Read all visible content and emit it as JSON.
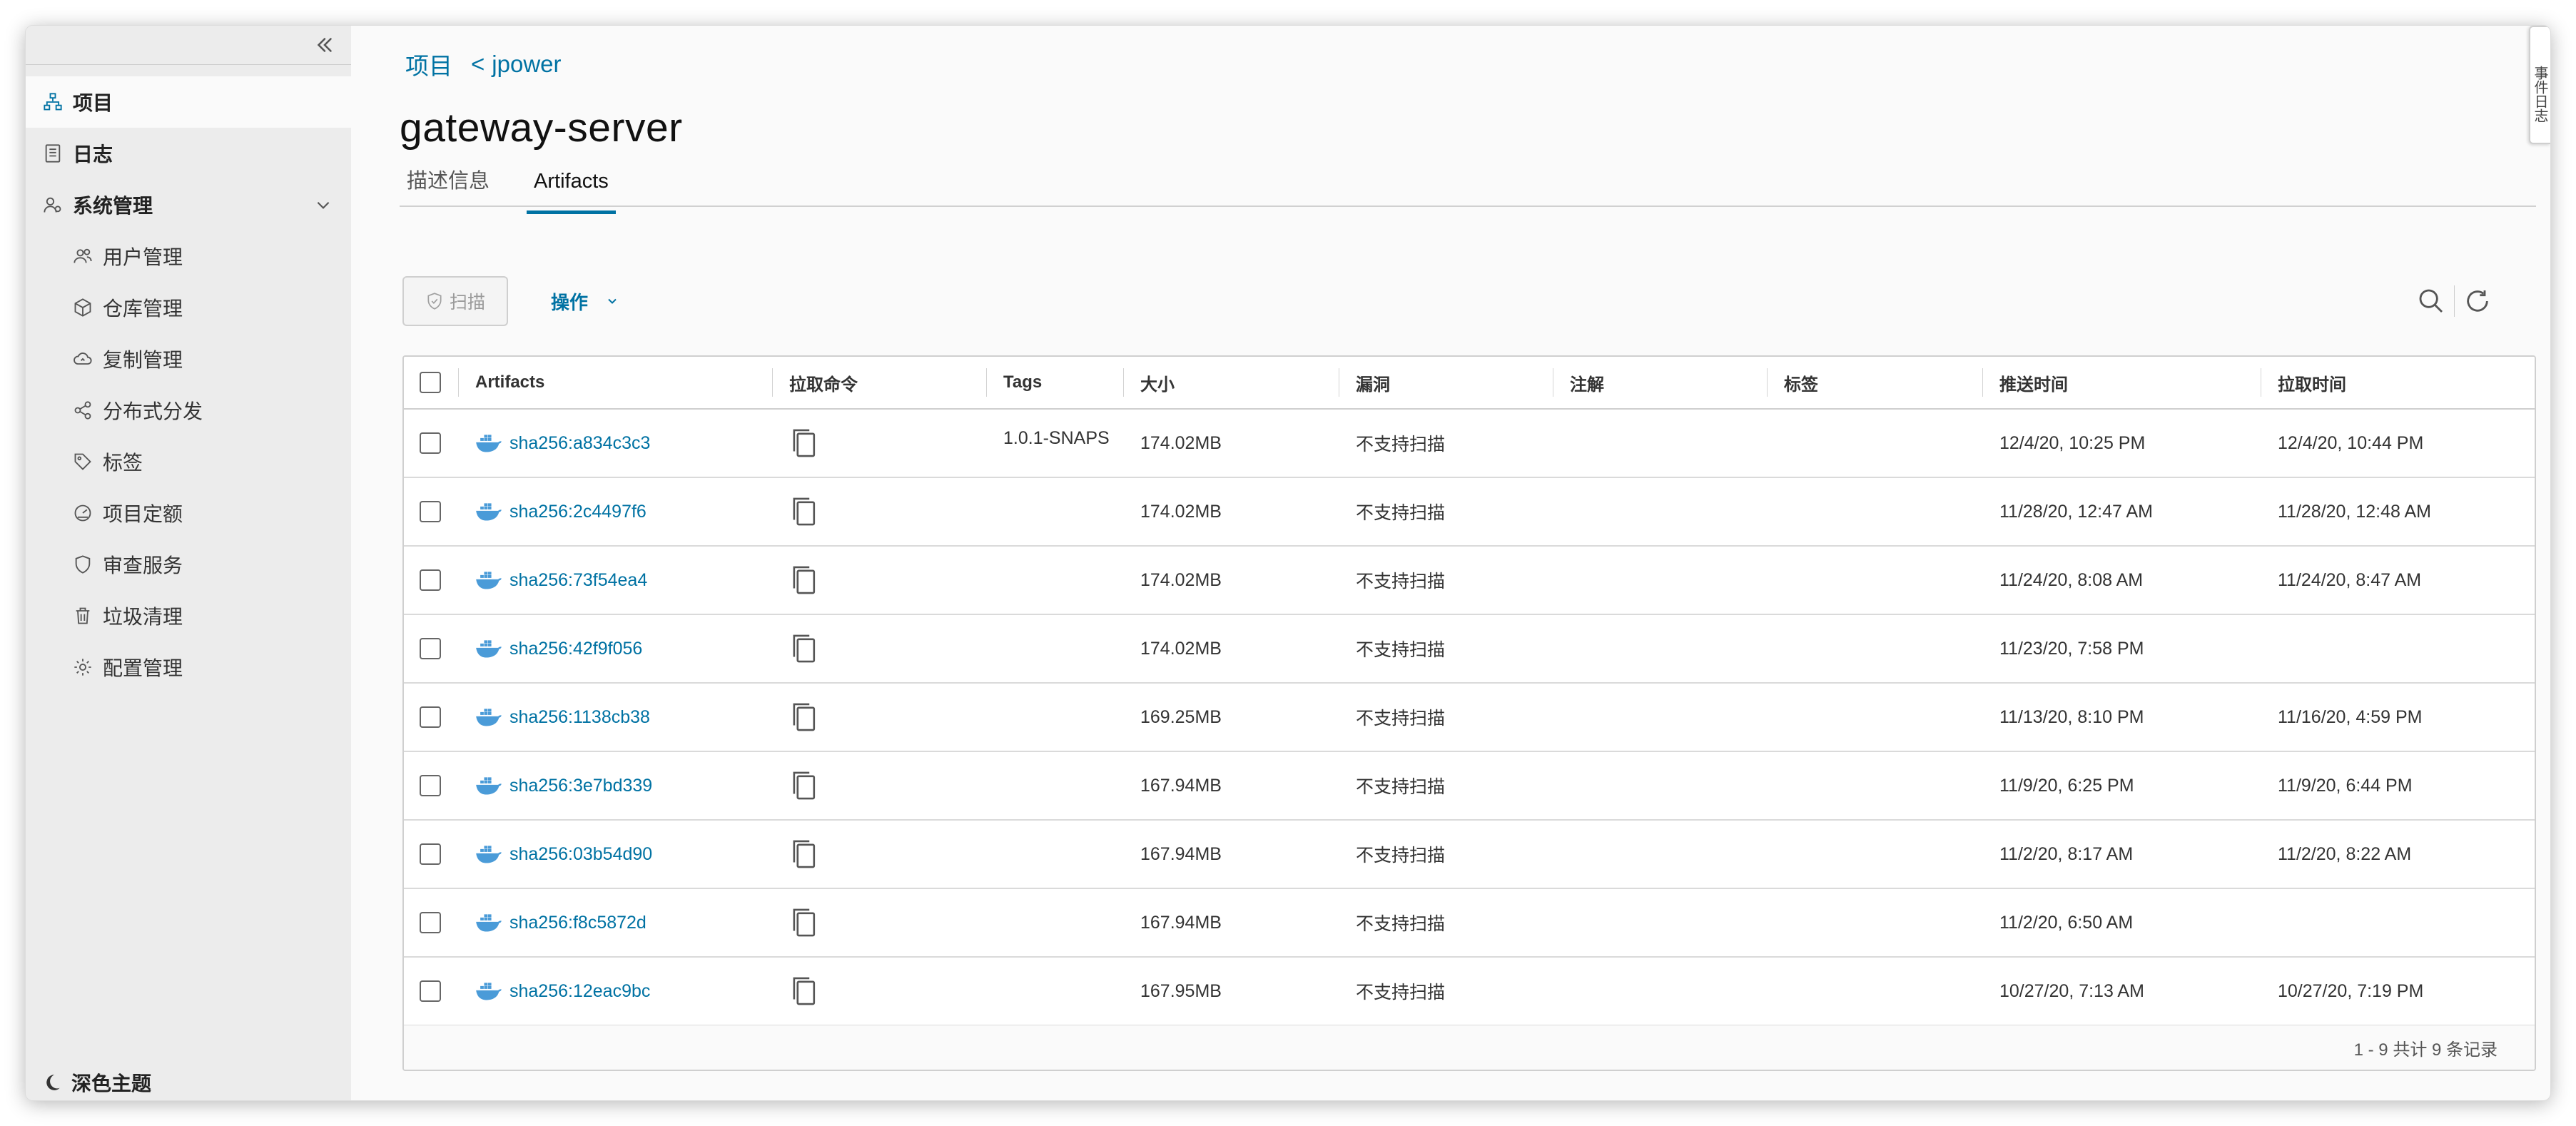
{
  "sidebar": {
    "items": [
      {
        "label": "项目",
        "icon": "project-icon"
      },
      {
        "label": "日志",
        "icon": "log-icon"
      },
      {
        "label": "系统管理",
        "icon": "admin-icon"
      },
      {
        "label": "用户管理",
        "icon": "users-icon"
      },
      {
        "label": "仓库管理",
        "icon": "registry-icon"
      },
      {
        "label": "复制管理",
        "icon": "replication-icon"
      },
      {
        "label": "分布式分发",
        "icon": "distribution-icon"
      },
      {
        "label": "标签",
        "icon": "tag-icon"
      },
      {
        "label": "项目定额",
        "icon": "quota-icon"
      },
      {
        "label": "审查服务",
        "icon": "shield-icon"
      },
      {
        "label": "垃圾清理",
        "icon": "trash-icon"
      },
      {
        "label": "配置管理",
        "icon": "gear-icon"
      }
    ],
    "theme_label": "深色主题"
  },
  "breadcrumb": {
    "root": "项目",
    "separator": "<",
    "project": "jpower"
  },
  "page_title": "gateway-server",
  "tabs": [
    {
      "label": "描述信息",
      "active": false
    },
    {
      "label": "Artifacts",
      "active": true
    }
  ],
  "toolbar": {
    "scan_label": "扫描",
    "action_label": "操作"
  },
  "table": {
    "headers": {
      "artifacts": "Artifacts",
      "pull": "拉取命令",
      "tags": "Tags",
      "size": "大小",
      "vulns": "漏洞",
      "annotations": "注解",
      "labels": "标签",
      "push_time": "推送时间",
      "pull_time": "拉取时间"
    },
    "rows": [
      {
        "digest": "sha256:a834c3c3",
        "tags": "1.0.1-SNAPS",
        "size": "174.02MB",
        "vulns": "不支持扫描",
        "push_time": "12/4/20, 10:25 PM",
        "pull_time": "12/4/20, 10:44 PM"
      },
      {
        "digest": "sha256:2c4497f6",
        "tags": "",
        "size": "174.02MB",
        "vulns": "不支持扫描",
        "push_time": "11/28/20, 12:47 AM",
        "pull_time": "11/28/20, 12:48 AM"
      },
      {
        "digest": "sha256:73f54ea4",
        "tags": "",
        "size": "174.02MB",
        "vulns": "不支持扫描",
        "push_time": "11/24/20, 8:08 AM",
        "pull_time": "11/24/20, 8:47 AM"
      },
      {
        "digest": "sha256:42f9f056",
        "tags": "",
        "size": "174.02MB",
        "vulns": "不支持扫描",
        "push_time": "11/23/20, 7:58 PM",
        "pull_time": ""
      },
      {
        "digest": "sha256:1138cb38",
        "tags": "",
        "size": "169.25MB",
        "vulns": "不支持扫描",
        "push_time": "11/13/20, 8:10 PM",
        "pull_time": "11/16/20, 4:59 PM"
      },
      {
        "digest": "sha256:3e7bd339",
        "tags": "",
        "size": "167.94MB",
        "vulns": "不支持扫描",
        "push_time": "11/9/20, 6:25 PM",
        "pull_time": "11/9/20, 6:44 PM"
      },
      {
        "digest": "sha256:03b54d90",
        "tags": "",
        "size": "167.94MB",
        "vulns": "不支持扫描",
        "push_time": "11/2/20, 8:17 AM",
        "pull_time": "11/2/20, 8:22 AM"
      },
      {
        "digest": "sha256:f8c5872d",
        "tags": "",
        "size": "167.94MB",
        "vulns": "不支持扫描",
        "push_time": "11/2/20, 6:50 AM",
        "pull_time": ""
      },
      {
        "digest": "sha256:12eac9bc",
        "tags": "",
        "size": "167.95MB",
        "vulns": "不支持扫描",
        "push_time": "10/27/20, 7:13 AM",
        "pull_time": "10/27/20, 7:19 PM"
      }
    ],
    "footer": "1 - 9 共计 9 条记录"
  },
  "side_handle": "事件日志",
  "colors": {
    "accent": "#0072a3",
    "artifact_icon": "#4a9bd8",
    "sidebar_bg": "#ececec"
  }
}
